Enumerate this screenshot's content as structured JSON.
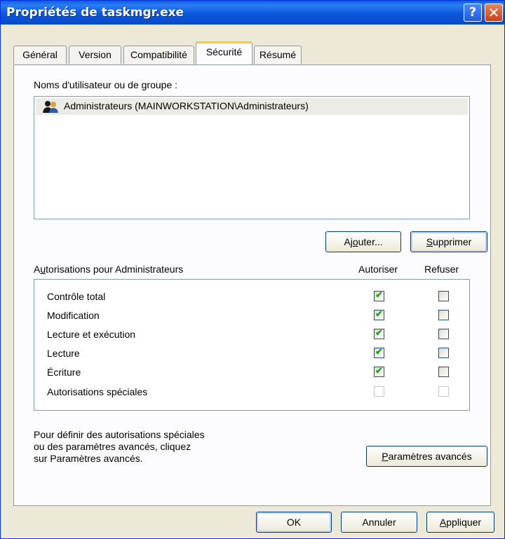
{
  "window": {
    "title": "Propriétés de taskmgr.exe"
  },
  "titlebar": {
    "help_label": "?",
    "close_label": "✕"
  },
  "tabs": [
    {
      "label": "Général"
    },
    {
      "label": "Version"
    },
    {
      "label": "Compatibilité"
    },
    {
      "label": "Sécurité"
    },
    {
      "label": "Résumé"
    }
  ],
  "active_tab": "Sécurité",
  "users": {
    "label": "Noms d'utilisateur ou de groupe :",
    "items": [
      {
        "name": "Administrateurs (MAINWORKSTATION\\Administrateurs)",
        "selected": true
      }
    ]
  },
  "buttons": {
    "add_pre": "Aj",
    "add_u": "o",
    "add_post": "uter...",
    "remove_u": "S",
    "remove_post": "upprimer",
    "advanced_u": "P",
    "advanced_post": "aramètres avancés",
    "ok": "OK",
    "cancel": "Annuler",
    "apply_u": "A",
    "apply_post": "ppliquer"
  },
  "permissions": {
    "label_pre": "A",
    "label_u": "u",
    "label_post": "torisations pour Administrateurs",
    "allow_header": "Autoriser",
    "deny_header": "Refuser",
    "rows": [
      {
        "name": "Contrôle total",
        "allow": true,
        "deny": false,
        "enabled": true
      },
      {
        "name": "Modification",
        "allow": true,
        "deny": false,
        "enabled": true
      },
      {
        "name": "Lecture et exécution",
        "allow": true,
        "deny": false,
        "enabled": true
      },
      {
        "name": "Lecture",
        "allow": true,
        "deny": false,
        "enabled": true
      },
      {
        "name": "Écriture",
        "allow": true,
        "deny": false,
        "enabled": true
      },
      {
        "name": "Autorisations spéciales",
        "allow": false,
        "deny": false,
        "enabled": false
      }
    ]
  },
  "advanced_hint": {
    "line1": "Pour définir des autorisations spéciales",
    "line2": "ou des paramètres avancés, cliquez",
    "line3": "sur Paramètres avancés."
  },
  "colors": {
    "titlebar": "#0a5fe0",
    "face": "#ece9d8",
    "check": "#21a121",
    "active_tab_accent": "#ffc83c"
  }
}
